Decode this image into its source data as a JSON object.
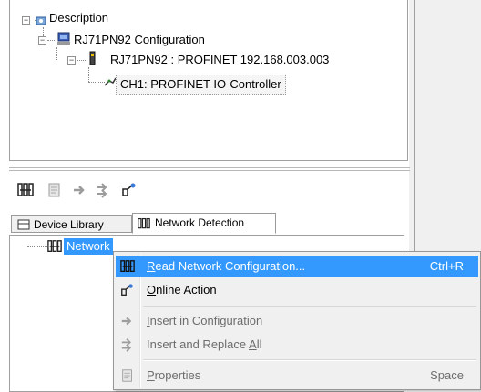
{
  "tree": {
    "root_label": "Description",
    "config_label": "RJ71PN92 Configuration",
    "device_label": "RJ71PN92 : PROFINET 192.168.003.003",
    "channel_label": "CH1: PROFINET IO-Controller"
  },
  "toolbar": {
    "icons": [
      "network-detection-icon",
      "properties-icon",
      "insert-icon",
      "insert-replace-icon",
      "online-action-icon"
    ]
  },
  "tabs": [
    {
      "label": "Device Library",
      "icon": "library-icon"
    },
    {
      "label": "Network Detection",
      "icon": "network-detection-icon"
    }
  ],
  "network_tree": {
    "item_label": "Network"
  },
  "context_menu": {
    "items": [
      {
        "pre": "",
        "mnemonic": "R",
        "post": "ead Network Configuration...",
        "shortcut": "Ctrl+R",
        "icon": "network-detection-icon",
        "highlighted": true,
        "enabled": true
      },
      {
        "pre": "",
        "mnemonic": "O",
        "post": "nline Action",
        "shortcut": "",
        "icon": "online-action-icon",
        "highlighted": false,
        "enabled": true
      },
      {
        "pre": "",
        "mnemonic": "I",
        "post": "nsert in Configuration",
        "shortcut": "",
        "icon": "insert-icon",
        "highlighted": false,
        "enabled": false
      },
      {
        "pre": "Insert and Replace ",
        "mnemonic": "A",
        "post": "ll",
        "shortcut": "",
        "icon": "insert-replace-icon",
        "highlighted": false,
        "enabled": false
      },
      {
        "pre": "",
        "mnemonic": "P",
        "post": "roperties",
        "shortcut": "Space",
        "icon": "properties-icon",
        "highlighted": false,
        "enabled": false
      }
    ]
  },
  "colors": {
    "selection": "#3399ff",
    "menu_background": "#f0f0f0",
    "disabled_text": "#6d6d6d"
  }
}
